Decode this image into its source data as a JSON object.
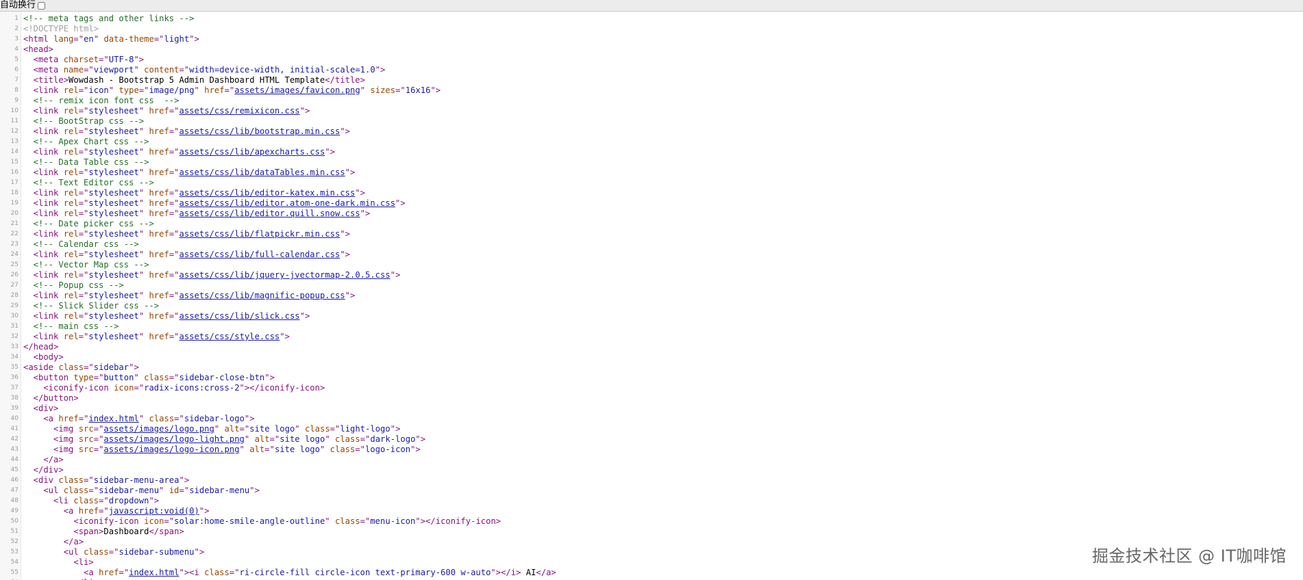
{
  "toolbar": {
    "wrap_label": "自动换行",
    "wrap_checked": false
  },
  "watermark": "掘金技术社区 @ IT咖啡馆",
  "colors": {
    "comment": "#236e25",
    "doctype": "#a0a0a0",
    "tag": "#881280",
    "attr": "#994500",
    "value": "#1a1aa6",
    "text": "#000000"
  },
  "lines": [
    [
      {
        "t": "c",
        "s": "<!-- meta tags and other links -->"
      }
    ],
    [
      {
        "t": "d",
        "s": "<!DOCTYPE html>"
      }
    ],
    [
      {
        "t": "g",
        "s": "<html "
      },
      {
        "t": "a",
        "s": "lang"
      },
      {
        "t": "g",
        "s": "=\""
      },
      {
        "t": "v",
        "s": "en"
      },
      {
        "t": "g",
        "s": "\" "
      },
      {
        "t": "a",
        "s": "data-theme"
      },
      {
        "t": "g",
        "s": "=\""
      },
      {
        "t": "v",
        "s": "light"
      },
      {
        "t": "g",
        "s": "\">"
      }
    ],
    [
      {
        "t": "g",
        "s": "<head>"
      }
    ],
    [
      {
        "t": "g",
        "s": "  <meta "
      },
      {
        "t": "a",
        "s": "charset"
      },
      {
        "t": "g",
        "s": "=\""
      },
      {
        "t": "v",
        "s": "UTF-8"
      },
      {
        "t": "g",
        "s": "\">"
      }
    ],
    [
      {
        "t": "g",
        "s": "  <meta "
      },
      {
        "t": "a",
        "s": "name"
      },
      {
        "t": "g",
        "s": "=\""
      },
      {
        "t": "v",
        "s": "viewport"
      },
      {
        "t": "g",
        "s": "\" "
      },
      {
        "t": "a",
        "s": "content"
      },
      {
        "t": "g",
        "s": "=\""
      },
      {
        "t": "v",
        "s": "width=device-width, initial-scale=1.0"
      },
      {
        "t": "g",
        "s": "\">"
      }
    ],
    [
      {
        "t": "g",
        "s": "  <title>"
      },
      {
        "t": "x",
        "s": "Wowdash - Bootstrap 5 Admin Dashboard HTML Template"
      },
      {
        "t": "g",
        "s": "</title>"
      }
    ],
    [
      {
        "t": "g",
        "s": "  <link "
      },
      {
        "t": "a",
        "s": "rel"
      },
      {
        "t": "g",
        "s": "=\""
      },
      {
        "t": "v",
        "s": "icon"
      },
      {
        "t": "g",
        "s": "\" "
      },
      {
        "t": "a",
        "s": "type"
      },
      {
        "t": "g",
        "s": "=\""
      },
      {
        "t": "v",
        "s": "image/png"
      },
      {
        "t": "g",
        "s": "\" "
      },
      {
        "t": "a",
        "s": "href"
      },
      {
        "t": "g",
        "s": "=\""
      },
      {
        "t": "l",
        "s": "assets/images/favicon.png"
      },
      {
        "t": "g",
        "s": "\" "
      },
      {
        "t": "a",
        "s": "sizes"
      },
      {
        "t": "g",
        "s": "=\""
      },
      {
        "t": "v",
        "s": "16x16"
      },
      {
        "t": "g",
        "s": "\">"
      }
    ],
    [
      {
        "t": "c",
        "s": "  <!-- remix icon font css  -->"
      }
    ],
    [
      {
        "t": "g",
        "s": "  <link "
      },
      {
        "t": "a",
        "s": "rel"
      },
      {
        "t": "g",
        "s": "=\""
      },
      {
        "t": "v",
        "s": "stylesheet"
      },
      {
        "t": "g",
        "s": "\" "
      },
      {
        "t": "a",
        "s": "href"
      },
      {
        "t": "g",
        "s": "=\""
      },
      {
        "t": "l",
        "s": "assets/css/remixicon.css"
      },
      {
        "t": "g",
        "s": "\">"
      }
    ],
    [
      {
        "t": "c",
        "s": "  <!-- BootStrap css -->"
      }
    ],
    [
      {
        "t": "g",
        "s": "  <link "
      },
      {
        "t": "a",
        "s": "rel"
      },
      {
        "t": "g",
        "s": "=\""
      },
      {
        "t": "v",
        "s": "stylesheet"
      },
      {
        "t": "g",
        "s": "\" "
      },
      {
        "t": "a",
        "s": "href"
      },
      {
        "t": "g",
        "s": "=\""
      },
      {
        "t": "l",
        "s": "assets/css/lib/bootstrap.min.css"
      },
      {
        "t": "g",
        "s": "\">"
      }
    ],
    [
      {
        "t": "c",
        "s": "  <!-- Apex Chart css -->"
      }
    ],
    [
      {
        "t": "g",
        "s": "  <link "
      },
      {
        "t": "a",
        "s": "rel"
      },
      {
        "t": "g",
        "s": "=\""
      },
      {
        "t": "v",
        "s": "stylesheet"
      },
      {
        "t": "g",
        "s": "\" "
      },
      {
        "t": "a",
        "s": "href"
      },
      {
        "t": "g",
        "s": "=\""
      },
      {
        "t": "l",
        "s": "assets/css/lib/apexcharts.css"
      },
      {
        "t": "g",
        "s": "\">"
      }
    ],
    [
      {
        "t": "c",
        "s": "  <!-- Data Table css -->"
      }
    ],
    [
      {
        "t": "g",
        "s": "  <link "
      },
      {
        "t": "a",
        "s": "rel"
      },
      {
        "t": "g",
        "s": "=\""
      },
      {
        "t": "v",
        "s": "stylesheet"
      },
      {
        "t": "g",
        "s": "\" "
      },
      {
        "t": "a",
        "s": "href"
      },
      {
        "t": "g",
        "s": "=\""
      },
      {
        "t": "l",
        "s": "assets/css/lib/dataTables.min.css"
      },
      {
        "t": "g",
        "s": "\">"
      }
    ],
    [
      {
        "t": "c",
        "s": "  <!-- Text Editor css -->"
      }
    ],
    [
      {
        "t": "g",
        "s": "  <link "
      },
      {
        "t": "a",
        "s": "rel"
      },
      {
        "t": "g",
        "s": "=\""
      },
      {
        "t": "v",
        "s": "stylesheet"
      },
      {
        "t": "g",
        "s": "\" "
      },
      {
        "t": "a",
        "s": "href"
      },
      {
        "t": "g",
        "s": "=\""
      },
      {
        "t": "l",
        "s": "assets/css/lib/editor-katex.min.css"
      },
      {
        "t": "g",
        "s": "\">"
      }
    ],
    [
      {
        "t": "g",
        "s": "  <link "
      },
      {
        "t": "a",
        "s": "rel"
      },
      {
        "t": "g",
        "s": "=\""
      },
      {
        "t": "v",
        "s": "stylesheet"
      },
      {
        "t": "g",
        "s": "\" "
      },
      {
        "t": "a",
        "s": "href"
      },
      {
        "t": "g",
        "s": "=\""
      },
      {
        "t": "l",
        "s": "assets/css/lib/editor.atom-one-dark.min.css"
      },
      {
        "t": "g",
        "s": "\">"
      }
    ],
    [
      {
        "t": "g",
        "s": "  <link "
      },
      {
        "t": "a",
        "s": "rel"
      },
      {
        "t": "g",
        "s": "=\""
      },
      {
        "t": "v",
        "s": "stylesheet"
      },
      {
        "t": "g",
        "s": "\" "
      },
      {
        "t": "a",
        "s": "href"
      },
      {
        "t": "g",
        "s": "=\""
      },
      {
        "t": "l",
        "s": "assets/css/lib/editor.quill.snow.css"
      },
      {
        "t": "g",
        "s": "\">"
      }
    ],
    [
      {
        "t": "c",
        "s": "  <!-- Date picker css -->"
      }
    ],
    [
      {
        "t": "g",
        "s": "  <link "
      },
      {
        "t": "a",
        "s": "rel"
      },
      {
        "t": "g",
        "s": "=\""
      },
      {
        "t": "v",
        "s": "stylesheet"
      },
      {
        "t": "g",
        "s": "\" "
      },
      {
        "t": "a",
        "s": "href"
      },
      {
        "t": "g",
        "s": "=\""
      },
      {
        "t": "l",
        "s": "assets/css/lib/flatpickr.min.css"
      },
      {
        "t": "g",
        "s": "\">"
      }
    ],
    [
      {
        "t": "c",
        "s": "  <!-- Calendar css -->"
      }
    ],
    [
      {
        "t": "g",
        "s": "  <link "
      },
      {
        "t": "a",
        "s": "rel"
      },
      {
        "t": "g",
        "s": "=\""
      },
      {
        "t": "v",
        "s": "stylesheet"
      },
      {
        "t": "g",
        "s": "\" "
      },
      {
        "t": "a",
        "s": "href"
      },
      {
        "t": "g",
        "s": "=\""
      },
      {
        "t": "l",
        "s": "assets/css/lib/full-calendar.css"
      },
      {
        "t": "g",
        "s": "\">"
      }
    ],
    [
      {
        "t": "c",
        "s": "  <!-- Vector Map css -->"
      }
    ],
    [
      {
        "t": "g",
        "s": "  <link "
      },
      {
        "t": "a",
        "s": "rel"
      },
      {
        "t": "g",
        "s": "=\""
      },
      {
        "t": "v",
        "s": "stylesheet"
      },
      {
        "t": "g",
        "s": "\" "
      },
      {
        "t": "a",
        "s": "href"
      },
      {
        "t": "g",
        "s": "=\""
      },
      {
        "t": "l",
        "s": "assets/css/lib/jquery-jvectormap-2.0.5.css"
      },
      {
        "t": "g",
        "s": "\">"
      }
    ],
    [
      {
        "t": "c",
        "s": "  <!-- Popup css -->"
      }
    ],
    [
      {
        "t": "g",
        "s": "  <link "
      },
      {
        "t": "a",
        "s": "rel"
      },
      {
        "t": "g",
        "s": "=\""
      },
      {
        "t": "v",
        "s": "stylesheet"
      },
      {
        "t": "g",
        "s": "\" "
      },
      {
        "t": "a",
        "s": "href"
      },
      {
        "t": "g",
        "s": "=\""
      },
      {
        "t": "l",
        "s": "assets/css/lib/magnific-popup.css"
      },
      {
        "t": "g",
        "s": "\">"
      }
    ],
    [
      {
        "t": "c",
        "s": "  <!-- Slick Slider css -->"
      }
    ],
    [
      {
        "t": "g",
        "s": "  <link "
      },
      {
        "t": "a",
        "s": "rel"
      },
      {
        "t": "g",
        "s": "=\""
      },
      {
        "t": "v",
        "s": "stylesheet"
      },
      {
        "t": "g",
        "s": "\" "
      },
      {
        "t": "a",
        "s": "href"
      },
      {
        "t": "g",
        "s": "=\""
      },
      {
        "t": "l",
        "s": "assets/css/lib/slick.css"
      },
      {
        "t": "g",
        "s": "\">"
      }
    ],
    [
      {
        "t": "c",
        "s": "  <!-- main css -->"
      }
    ],
    [
      {
        "t": "g",
        "s": "  <link "
      },
      {
        "t": "a",
        "s": "rel"
      },
      {
        "t": "g",
        "s": "=\""
      },
      {
        "t": "v",
        "s": "stylesheet"
      },
      {
        "t": "g",
        "s": "\" "
      },
      {
        "t": "a",
        "s": "href"
      },
      {
        "t": "g",
        "s": "=\""
      },
      {
        "t": "l",
        "s": "assets/css/style.css"
      },
      {
        "t": "g",
        "s": "\">"
      }
    ],
    [
      {
        "t": "g",
        "s": "</head>"
      }
    ],
    [
      {
        "t": "g",
        "s": "  <body>"
      }
    ],
    [
      {
        "t": "g",
        "s": "<aside "
      },
      {
        "t": "a",
        "s": "class"
      },
      {
        "t": "g",
        "s": "=\""
      },
      {
        "t": "v",
        "s": "sidebar"
      },
      {
        "t": "g",
        "s": "\">"
      }
    ],
    [
      {
        "t": "g",
        "s": "  <button "
      },
      {
        "t": "a",
        "s": "type"
      },
      {
        "t": "g",
        "s": "=\""
      },
      {
        "t": "v",
        "s": "button"
      },
      {
        "t": "g",
        "s": "\" "
      },
      {
        "t": "a",
        "s": "class"
      },
      {
        "t": "g",
        "s": "=\""
      },
      {
        "t": "v",
        "s": "sidebar-close-btn"
      },
      {
        "t": "g",
        "s": "\">"
      }
    ],
    [
      {
        "t": "g",
        "s": "    <iconify-icon "
      },
      {
        "t": "a",
        "s": "icon"
      },
      {
        "t": "g",
        "s": "=\""
      },
      {
        "t": "v",
        "s": "radix-icons:cross-2"
      },
      {
        "t": "g",
        "s": "\"></iconify-icon>"
      }
    ],
    [
      {
        "t": "g",
        "s": "  </button>"
      }
    ],
    [
      {
        "t": "g",
        "s": "  <div>"
      }
    ],
    [
      {
        "t": "g",
        "s": "    <a "
      },
      {
        "t": "a",
        "s": "href"
      },
      {
        "t": "g",
        "s": "=\""
      },
      {
        "t": "l",
        "s": "index.html"
      },
      {
        "t": "g",
        "s": "\" "
      },
      {
        "t": "a",
        "s": "class"
      },
      {
        "t": "g",
        "s": "=\""
      },
      {
        "t": "v",
        "s": "sidebar-logo"
      },
      {
        "t": "g",
        "s": "\">"
      }
    ],
    [
      {
        "t": "g",
        "s": "      <img "
      },
      {
        "t": "a",
        "s": "src"
      },
      {
        "t": "g",
        "s": "=\""
      },
      {
        "t": "l",
        "s": "assets/images/logo.png"
      },
      {
        "t": "g",
        "s": "\" "
      },
      {
        "t": "a",
        "s": "alt"
      },
      {
        "t": "g",
        "s": "=\""
      },
      {
        "t": "v",
        "s": "site logo"
      },
      {
        "t": "g",
        "s": "\" "
      },
      {
        "t": "a",
        "s": "class"
      },
      {
        "t": "g",
        "s": "=\""
      },
      {
        "t": "v",
        "s": "light-logo"
      },
      {
        "t": "g",
        "s": "\">"
      }
    ],
    [
      {
        "t": "g",
        "s": "      <img "
      },
      {
        "t": "a",
        "s": "src"
      },
      {
        "t": "g",
        "s": "=\""
      },
      {
        "t": "l",
        "s": "assets/images/logo-light.png"
      },
      {
        "t": "g",
        "s": "\" "
      },
      {
        "t": "a",
        "s": "alt"
      },
      {
        "t": "g",
        "s": "=\""
      },
      {
        "t": "v",
        "s": "site logo"
      },
      {
        "t": "g",
        "s": "\" "
      },
      {
        "t": "a",
        "s": "class"
      },
      {
        "t": "g",
        "s": "=\""
      },
      {
        "t": "v",
        "s": "dark-logo"
      },
      {
        "t": "g",
        "s": "\">"
      }
    ],
    [
      {
        "t": "g",
        "s": "      <img "
      },
      {
        "t": "a",
        "s": "src"
      },
      {
        "t": "g",
        "s": "=\""
      },
      {
        "t": "l",
        "s": "assets/images/logo-icon.png"
      },
      {
        "t": "g",
        "s": "\" "
      },
      {
        "t": "a",
        "s": "alt"
      },
      {
        "t": "g",
        "s": "=\""
      },
      {
        "t": "v",
        "s": "site logo"
      },
      {
        "t": "g",
        "s": "\" "
      },
      {
        "t": "a",
        "s": "class"
      },
      {
        "t": "g",
        "s": "=\""
      },
      {
        "t": "v",
        "s": "logo-icon"
      },
      {
        "t": "g",
        "s": "\">"
      }
    ],
    [
      {
        "t": "g",
        "s": "    </a>"
      }
    ],
    [
      {
        "t": "g",
        "s": "  </div>"
      }
    ],
    [
      {
        "t": "g",
        "s": "  <div "
      },
      {
        "t": "a",
        "s": "class"
      },
      {
        "t": "g",
        "s": "=\""
      },
      {
        "t": "v",
        "s": "sidebar-menu-area"
      },
      {
        "t": "g",
        "s": "\">"
      }
    ],
    [
      {
        "t": "g",
        "s": "    <ul "
      },
      {
        "t": "a",
        "s": "class"
      },
      {
        "t": "g",
        "s": "=\""
      },
      {
        "t": "v",
        "s": "sidebar-menu"
      },
      {
        "t": "g",
        "s": "\" "
      },
      {
        "t": "a",
        "s": "id"
      },
      {
        "t": "g",
        "s": "=\""
      },
      {
        "t": "v",
        "s": "sidebar-menu"
      },
      {
        "t": "g",
        "s": "\">"
      }
    ],
    [
      {
        "t": "g",
        "s": "      <li "
      },
      {
        "t": "a",
        "s": "class"
      },
      {
        "t": "g",
        "s": "=\""
      },
      {
        "t": "v",
        "s": "dropdown"
      },
      {
        "t": "g",
        "s": "\">"
      }
    ],
    [
      {
        "t": "g",
        "s": "        <a "
      },
      {
        "t": "a",
        "s": "href"
      },
      {
        "t": "g",
        "s": "=\""
      },
      {
        "t": "l",
        "s": "javascript:void(0)"
      },
      {
        "t": "g",
        "s": "\">"
      }
    ],
    [
      {
        "t": "g",
        "s": "          <iconify-icon "
      },
      {
        "t": "a",
        "s": "icon"
      },
      {
        "t": "g",
        "s": "=\""
      },
      {
        "t": "v",
        "s": "solar:home-smile-angle-outline"
      },
      {
        "t": "g",
        "s": "\" "
      },
      {
        "t": "a",
        "s": "class"
      },
      {
        "t": "g",
        "s": "=\""
      },
      {
        "t": "v",
        "s": "menu-icon"
      },
      {
        "t": "g",
        "s": "\"></iconify-icon>"
      }
    ],
    [
      {
        "t": "g",
        "s": "          <span>"
      },
      {
        "t": "x",
        "s": "Dashboard"
      },
      {
        "t": "g",
        "s": "</span>"
      }
    ],
    [
      {
        "t": "g",
        "s": "        </a>"
      }
    ],
    [
      {
        "t": "g",
        "s": "        <ul "
      },
      {
        "t": "a",
        "s": "class"
      },
      {
        "t": "g",
        "s": "=\""
      },
      {
        "t": "v",
        "s": "sidebar-submenu"
      },
      {
        "t": "g",
        "s": "\">"
      }
    ],
    [
      {
        "t": "g",
        "s": "          <li>"
      }
    ],
    [
      {
        "t": "g",
        "s": "            <a "
      },
      {
        "t": "a",
        "s": "href"
      },
      {
        "t": "g",
        "s": "=\""
      },
      {
        "t": "l",
        "s": "index.html"
      },
      {
        "t": "g",
        "s": "\"><i "
      },
      {
        "t": "a",
        "s": "class"
      },
      {
        "t": "g",
        "s": "=\""
      },
      {
        "t": "v",
        "s": "ri-circle-fill circle-icon text-primary-600 w-auto"
      },
      {
        "t": "g",
        "s": "\"></i> "
      },
      {
        "t": "x",
        "s": "AI"
      },
      {
        "t": "g",
        "s": "</a>"
      }
    ],
    [
      {
        "t": "g",
        "s": "          </li>"
      }
    ]
  ]
}
